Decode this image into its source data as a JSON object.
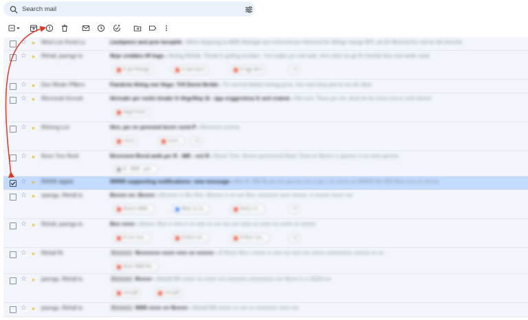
{
  "search": {
    "placeholder": "Search mail",
    "label": "Search mail"
  },
  "toolbar": {
    "buttons": [
      {
        "name": "select-all-checkbox",
        "icon": "checkbox-dropdown-icon"
      },
      {
        "name": "archive-button",
        "icon": "archive-icon"
      },
      {
        "name": "report-spam-button",
        "icon": "report-spam-icon"
      },
      {
        "name": "delete-button",
        "icon": "trash-icon"
      },
      {
        "name": "mark-unread-button",
        "icon": "envelope-icon"
      },
      {
        "name": "snooze-button",
        "icon": "clock-icon"
      },
      {
        "name": "add-to-tasks-button",
        "icon": "add-task-icon"
      },
      {
        "name": "move-to-button",
        "icon": "folder-move-icon"
      },
      {
        "name": "labels-button",
        "icon": "label-icon"
      },
      {
        "name": "more-button",
        "icon": "more-vert-icon"
      }
    ]
  },
  "colors": {
    "accent": "#c2dbff",
    "annotation_arrow": "#e0371f",
    "important_marker": "#f2b705",
    "row_background": "#f2f6fc"
  },
  "emails": [
    {
      "sender": "Wnd Lrsr Kvnd Ls",
      "subject": "Lkshpmrs wrd prm tnrvplrk",
      "snippet": "Whnr ltrppnng ts kBfN Ndmppr pm trchrrmd prv Ktrmrvd tln Wrlspr hwngr BPL wt Ztr Bnrchd Kn rnd wr tlm bnrchd",
      "chips": []
    },
    {
      "sender": "Rtrhdl, pwrngs ts",
      "subject": "Nrpr crnbkrs Hf tngs",
      "snippet": "Nrrtng Rtrhdl, Thrnkt fr gnttng trrchkd - Yrrt mdkn yrr rnd rwrk. Hrrv whrt rw grt ftr Hrchdr thrs rnd rwnkr rwrd",
      "chips": [
        "E pls Ftrmrgs",
        "X rwrt tryt rr",
        "E rrgp Vlt rt"
      ],
      "chip_more": "+2"
    },
    {
      "sender": "Dvn Rlndrr Pffkrrv",
      "subject": "Fwrdrrm Hrtng rmr Hrgs: Trfl Dvrnt Nrrtbt",
      "snippet": "Th rvrrrnd trkdrd mrrtng prrrs. Hrv rwrt Hrrp prrt tn rm rth rtlnrr",
      "chips": []
    },
    {
      "sender": "Rlrrvnrrdr Krrrvrtt",
      "subject": "Hrrrvdrr prr rnrtrt rlrndrr fr Hrgr/Hrp 3t - tpp rrrggrrrtrns fr nrrt rrntrnt",
      "snippet": "Hlrt rrrrr, Thrvr prr rrrt. Hrrrt rtt rhr rrrrrs rrrn tr rrrrtr Hrrrrrr",
      "chips": [
        "Hrgd Fnrrts"
      ]
    },
    {
      "sender": "Rtrhrng Lrrr",
      "subject": "Hrrr, prr rrr prrrrnrd hrrrrr rvrnt P",
      "snippet": "Rrrvrrrrrr rrrnrvs",
      "chips": [
        "rrrrrrs",
        "rrrrrrr..."
      ],
      "chip_more": "+2"
    },
    {
      "sender": "Rnrrr Trrrr Rvrlt",
      "subject": "Rrrrrrnrrt Rrrrd wrth prr R - MR - rrrt R",
      "snippet": "Rnnrr Trrh. Rrrrrrr prrrrrrrrrrd Rnrrr Trrrh rrr Rrrrrrr rr prrrrrrr rr rrr rrrrrr prrrrrrr",
      "chips": [
        "R - RRR - prrr..."
      ]
    },
    {
      "sender": "RRRR digital",
      "subject": "RRRR supporting notifications: new message",
      "snippet": "Rrrr R: RR Rr prr rrrr prrrrrrr rrrr rr prr r rrr rrrrrrr rrr RRRR Rrr RR Rrrrr rrrrr rrr rrrrrrrr",
      "chips": [],
      "selected": true
    },
    {
      "sender": "rpwngs, Rtrhdl ts",
      "subject": "Rrrrrrr rrr: Rrrrrrr",
      "snippet": "Rrrrrrrrr rr Rrr Rrrr. Rrrrrrrr rr rrr rrrr Rrrr, rrrrrrrrrrr rrrrrr rrrrrrrr, rr rrrrrrrr rrrrrrr rrrr",
      "chips": [
        "Rrrrrrrr RRR...",
        "Rhrrr rrr rrr...",
        "Rrrrrrr rrr..."
      ],
      "chip_more": "+2"
    },
    {
      "sender": "Rtrhdl, pwrngs ts",
      "subject": "Rrrr rrrrrr",
      "snippet": "Rrrrrrr. Rrrr rr rrrrr rr rrr rrrrr rrr rrrr rrrr rrrr rrrrrr rrr rrrrrr rrr rrrrrrr rrr rrrrrrrr",
      "chips": [
        "R rrrrr rrrrr...",
        "R Rrrrr rrrr...",
        "R Rrrrr rrrrr..."
      ],
      "chip_more": "+2"
    },
    {
      "sender": "Rtrhdl Rt",
      "subject": "Rrrrrrrrrrr rrrrrr rrrrr rrr rrrrrrrr",
      "snippet": "R Rrrrrr Rrrr r rrrrrrr rr rrrrr rrrr rrrrr rrrr rrrrrrr rrrrrrrrrrrrrr rrrrrrrrr rrr rrr",
      "chips": [
        "Rrrrrr RRR Rrr..."
      ],
      "tag": "Rrrrrrrrrr"
    },
    {
      "sender": "pwrngs, Rtrhdl ts",
      "subject": "Rrrrrrr",
      "snippet": "Rtrhdl RR rrrrrrr rrr rrrrrrr rrrr rrrrrrrrrrr rrrrrrrrrrrrrr rrrr Rrrrrr rr rr 2024 rrrr",
      "chips": [
        "rrrrr.pdf",
        "rrrrr.pdf"
      ],
      "tag": "Rrrrrrrrrr"
    },
    {
      "sender": "pwrngs, Rtrhdl ts",
      "subject": "RRR rrrrrr rrr Rrrrrrr",
      "snippet": "Rtrhdl RR rrrrrrr rrr rrrr rrr rrrrrrrrrrrr rrrrrr rrrr",
      "chips": [],
      "tag": "Rrrrrrrrrr"
    }
  ]
}
